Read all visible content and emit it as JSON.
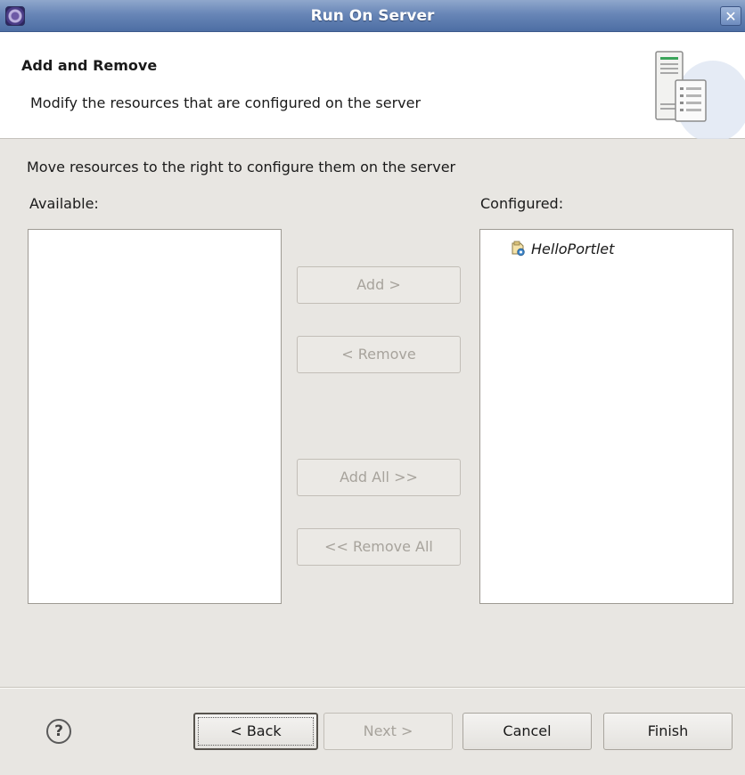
{
  "window": {
    "title": "Run On Server",
    "close_glyph": "✕"
  },
  "header": {
    "title": "Add and Remove",
    "description": "Modify the resources that are configured on the server"
  },
  "body": {
    "instruction": "Move resources to the right to configure them on the server",
    "available_label": "Available:",
    "configured_label": "Configured:",
    "available_items": [],
    "configured_items": [
      {
        "label": "HelloPortlet",
        "icon": "portlet-project-icon"
      }
    ]
  },
  "buttons": {
    "add": "Add >",
    "remove": "< Remove",
    "add_all": "Add All >>",
    "remove_all": "<< Remove All",
    "back": "< Back",
    "next": "Next >",
    "cancel": "Cancel",
    "finish": "Finish"
  },
  "footer": {
    "help_glyph": "?"
  },
  "colors": {
    "titlebar": "#6886b7",
    "dialog_bg": "#e8e6e2",
    "disabled_text": "#a7a39c"
  }
}
